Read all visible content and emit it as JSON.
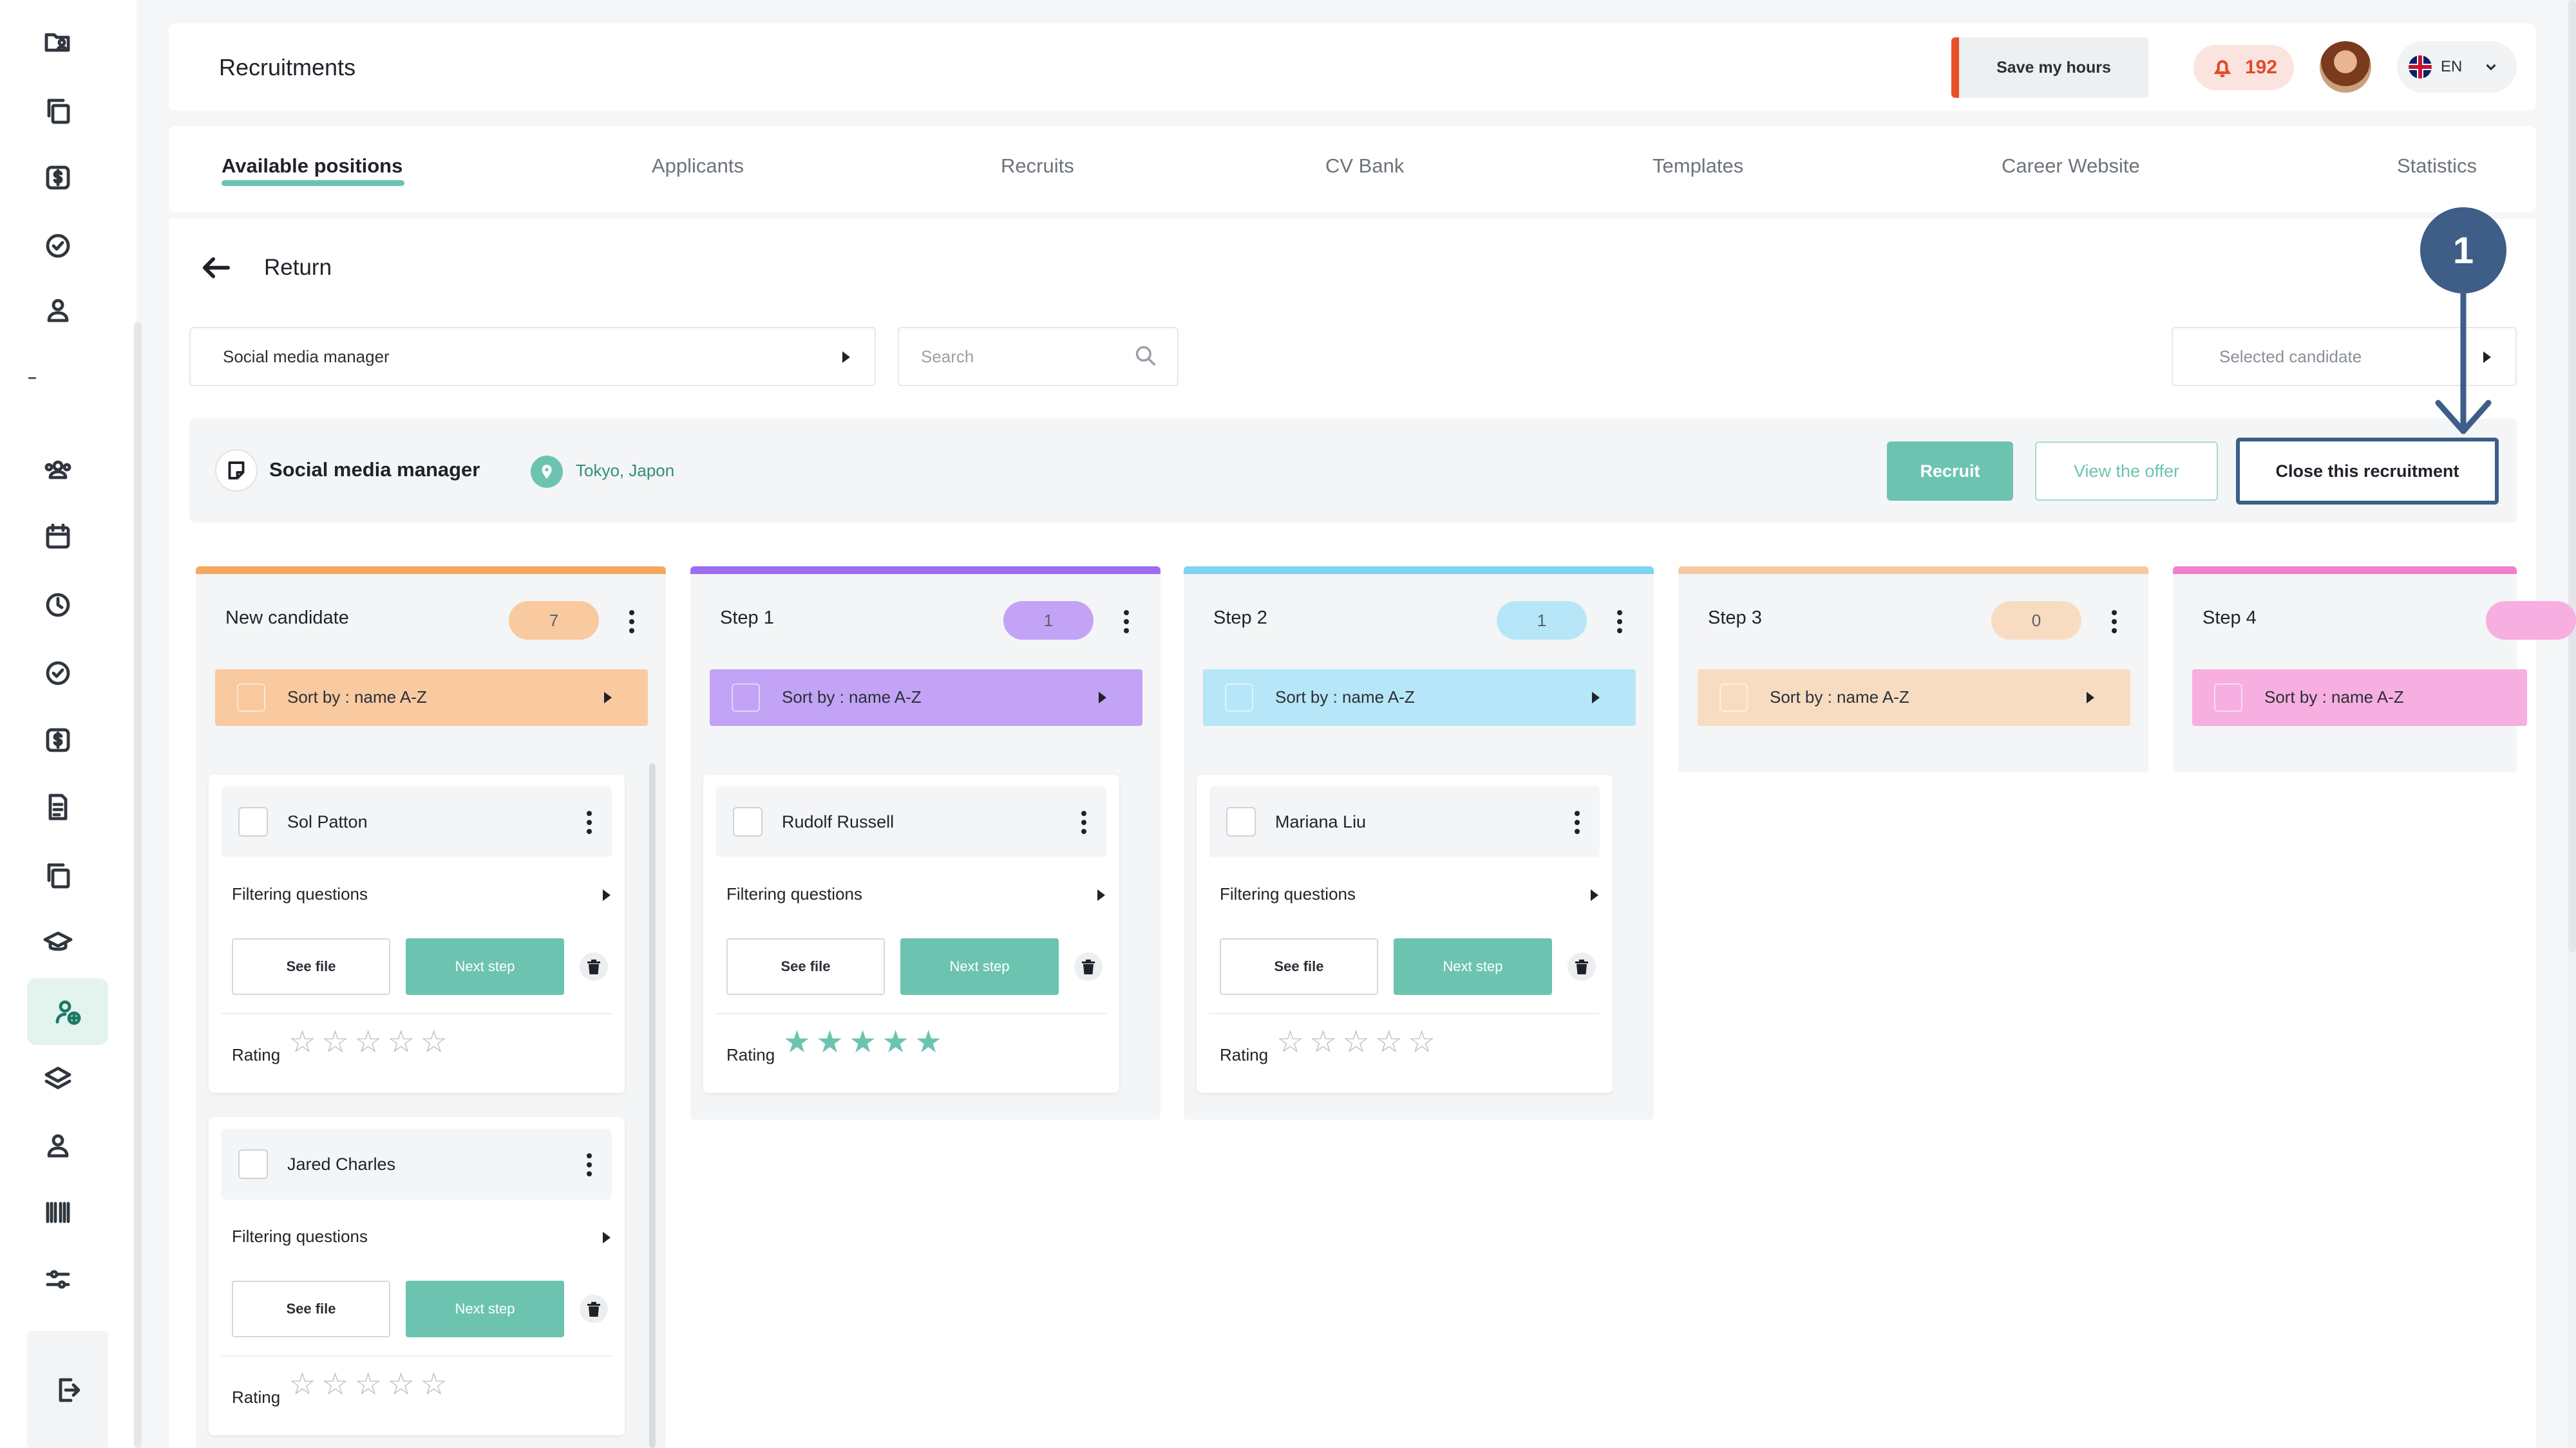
{
  "header": {
    "title": "Recruitments",
    "save_hours": "Save my hours",
    "notification_count": "192",
    "language": "EN"
  },
  "tabs": [
    {
      "label": "Available positions",
      "active": true
    },
    {
      "label": "Applicants"
    },
    {
      "label": "Recruits"
    },
    {
      "label": "CV Bank"
    },
    {
      "label": "Templates"
    },
    {
      "label": "Career Website"
    },
    {
      "label": "Statistics"
    }
  ],
  "toolbar": {
    "return_label": "Return",
    "position_value": "Social media manager",
    "search_placeholder": "Search",
    "selected_candidate_placeholder": "Selected candidate"
  },
  "offer": {
    "title": "Social media manager",
    "location": "Tokyo, Japon",
    "recruit_label": "Recruit",
    "view_offer_label": "View the offer",
    "close_label": "Close this recruitment"
  },
  "annotation": {
    "step": "1"
  },
  "columns": [
    {
      "title": "New candidate",
      "count": "7",
      "sort_label": "Sort by : name A-Z",
      "color": "#f6a862",
      "sort_bg": "#f9c9a0",
      "count_bg": "#f9c9a0"
    },
    {
      "title": "Step 1",
      "count": "1",
      "sort_label": "Sort by : name A-Z",
      "color": "#9b6cf0",
      "sort_bg": "#c2a3f6",
      "count_bg": "#c2a3f6"
    },
    {
      "title": "Step 2",
      "count": "1",
      "sort_label": "Sort by : name A-Z",
      "color": "#7fd3f3",
      "sort_bg": "#b6e6f8",
      "count_bg": "#b6e6f8"
    },
    {
      "title": "Step 3",
      "count": "0",
      "sort_label": "Sort by : name A-Z",
      "color": "#f5c9a2",
      "sort_bg": "#f8dcc2",
      "count_bg": "#f8dcc2"
    },
    {
      "title": "Step 4",
      "count": "",
      "sort_label": "Sort by : name A-Z",
      "color": "#f07fcc",
      "sort_bg": "#f7aee0",
      "count_bg": "#f7aee0"
    }
  ],
  "card_labels": {
    "filtering": "Filtering questions",
    "see_file": "See file",
    "next_step": "Next step",
    "rating": "Rating"
  },
  "cards": [
    {
      "column": 0,
      "name": "Sol Patton",
      "rating": 0
    },
    {
      "column": 0,
      "name": "Jared Charles",
      "rating": 0
    },
    {
      "column": 1,
      "name": "Rudolf Russell",
      "rating": 5
    },
    {
      "column": 2,
      "name": "Mariana Liu",
      "rating": 0
    }
  ]
}
